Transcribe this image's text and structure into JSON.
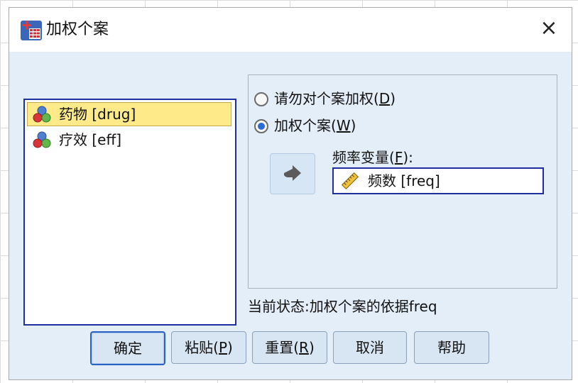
{
  "window": {
    "title": "加权个案",
    "close_glyph": "×"
  },
  "variables": [
    {
      "label": "药物 [drug]",
      "icon": "nominal-icon",
      "selected": true
    },
    {
      "label": "疗效 [eff]",
      "icon": "nominal-icon",
      "selected": false
    }
  ],
  "options": {
    "no_weight": {
      "text": "请勿对个案加权(",
      "mnemonic": "D",
      "suffix": ")",
      "checked": false
    },
    "weight_by": {
      "text": "加权个案(",
      "mnemonic": "W",
      "suffix": ")",
      "checked": true
    }
  },
  "frequency": {
    "label_text": "频率变量(",
    "label_mnemonic": "F",
    "label_suffix": "):",
    "value": "频数 [freq]",
    "icon": "ruler-icon"
  },
  "status_text": "当前状态:加权个案的依据freq",
  "buttons": {
    "ok": "确定",
    "paste_text": "粘贴(",
    "paste_mnemonic": "P",
    "paste_suffix": ")",
    "reset_text": "重置(",
    "reset_mnemonic": "R",
    "reset_suffix": ")",
    "cancel": "取消",
    "help": "帮助"
  },
  "colors": {
    "client_bg": "#e3eef9",
    "focus_border": "#1f2f9c",
    "selected_bg": "#ffea8a",
    "radio_dot": "#2c6bd6"
  }
}
